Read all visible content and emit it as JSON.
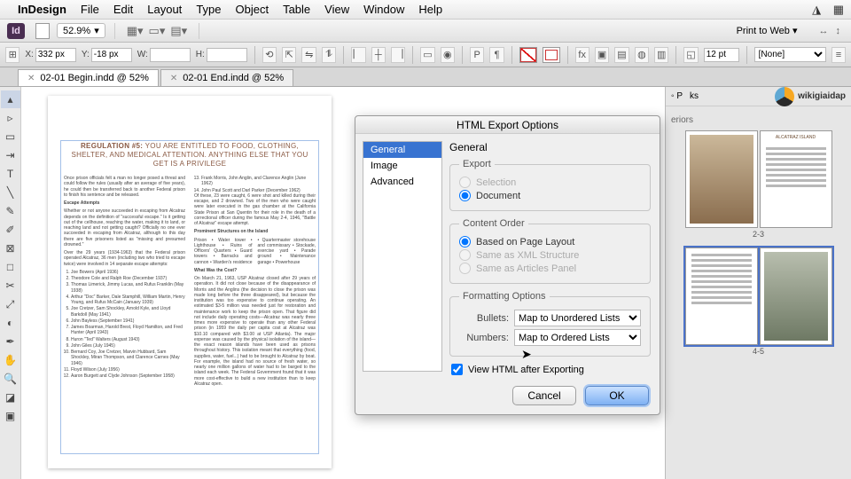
{
  "menubar": {
    "apple": "",
    "brand": "InDesign",
    "items": [
      "File",
      "Edit",
      "Layout",
      "Type",
      "Object",
      "Table",
      "View",
      "Window",
      "Help"
    ]
  },
  "appbar": {
    "id_logo": "Id",
    "zoom": "52.9%",
    "print_to_web": "Print to Web"
  },
  "control": {
    "x_label": "X:",
    "x_value": "332 px",
    "y_label": "Y:",
    "y_value": "-18 px",
    "w_label": "W:",
    "w_value": "",
    "h_label": "H:",
    "h_value": "",
    "stroke_pt": "12 pt",
    "style_none": "[None]"
  },
  "tabs": [
    {
      "label": "02-01 Begin.indd @ 52%",
      "active": true
    },
    {
      "label": "02-01 End.indd @ 52%",
      "active": false
    }
  ],
  "document": {
    "headline_label": "REGULATION #5:",
    "headline_body": "YOU ARE ENTITLED TO FOOD, CLOTHING, SHELTER, AND MEDICAL ATTENTION. ANYTHING ELSE THAT YOU GET IS A PRIVILEGE",
    "para1": "Once prison officials felt a man no longer posed a threat and could follow the rules (usually after an average of five years), he could then be transferred back to another Federal prison to finish his sentence and be released.",
    "escape_h": "Escape Attempts",
    "para2": "Whether or not anyone succeeded in escaping from Alcatraz depends on the definition of \"successful escape.\" Is it getting out of the cellhouse, reaching the water, making it to land, or reaching land and not getting caught? Officially no one ever succeeded in escaping from Alcatraz, although to this day there are five prisoners listed as \"missing and presumed drowned.\"",
    "para3": "Over the 29 years (1934-1963) that the Federal prison operated Alcatraz, 36 men (including two who tried to escape twice) were involved in 14 separate escape attempts:",
    "names": [
      "Joe Bowers (April 1936)",
      "Theodore Cole and Ralph Roe (December 1937)",
      "Thomas Limerick, Jimmy Lucas, and Rufus Franklin (May 1938)",
      "Arthur \"Doc\" Barker, Dale Stamphill, William Martin, Henry Young, and Rufus McCain (January 1939)",
      "Joe Cretzer, Sam Shockley, Arnold Kyle, and Lloyd Barkdoll (May 1941)",
      "John Bayless (September 1941)",
      "James Boarman, Harold Brest, Floyd Hamilton, and Fred Hunter (April 1943)",
      "Huron \"Ted\" Walters (August 1943)",
      "John Giles (July 1945)",
      "Bernard Coy, Joe Cretzer, Marvin Hubbard, Sam Shockley, Miran Thompson, and Clarence Carnes (May 1946)",
      "Floyd Wilson (July 1956)",
      "Aaron Burgett and Clyde Johnson (September 1958)",
      "Frank Morris, John Anglin, and Clarence Anglin (June 1962)",
      "John Paul Scott and Darl Parker (December 1962)"
    ],
    "col2p1": "Of these, 23 were caught, 6 were shot and killed during their escape, and 2 drowned. Two of the men who were caught were later executed in the gas chamber at the California State Prison at San Quentin for their role in the death of a correctional officer during the famous May 2-4, 1946, \"Battle of Alcatraz\" escape attempt.",
    "struct_h": "Prominent Structures on the Island",
    "struct_list": [
      "Prison",
      "Water tower",
      "Lighthouse",
      "Ruins of Officers' Quarters",
      "Guard towers",
      "Barracks and cannon",
      "Warden's residence",
      "Quartermaster storehouse and commissary",
      "Stockade, exercise yard",
      "Parade ground",
      "Maintenance garage",
      "Powerhouse"
    ],
    "cost_h": "What Was the Cost?",
    "col2p2": "On March 21, 1963, USP Alcatraz closed after 29 years of operation. It did not close because of the disappearance of Morris and the Anglins (the decision to close the prison was made long before the three disappeared), but because the institution was too expensive to continue operating. An estimated $3-5 million was needed just for restoration and maintenance work to keep the prison open. That figure did not include daily operating costs—Alcatraz was nearly three times more expensive to operate than any other Federal prison (in 1959 the daily per capita cost at Alcatraz was $10.10 compared with $3.00 at USP Atlanta). The major expense was caused by the physical isolation of the island—the exact reason islands have been used as prisons throughout history. This isolation meant that everything (food, supplies, water, fuel...) had to be brought to Alcatraz by boat. For example, the island had no source of fresh water, so nearly one million gallons of water had to be barged to the island each week. The Federal Government found that it was more cost-effective to build a new institution than to keep Alcatraz open."
  },
  "panels": {
    "tab_pages": "P",
    "tab_links": "ks",
    "logo_text": "wikigiaidap",
    "subtab": "eriors",
    "spread1_label": "2-3",
    "spread2_label": "4-5",
    "alcatraz_label": "ALCATRAZ ISLAND"
  },
  "dialog": {
    "title": "HTML Export Options",
    "side": {
      "general": "General",
      "image": "Image",
      "advanced": "Advanced"
    },
    "section": "General",
    "export_legend": "Export",
    "export_selection": "Selection",
    "export_document": "Document",
    "content_legend": "Content Order",
    "co_layout": "Based on Page Layout",
    "co_xml": "Same as XML Structure",
    "co_articles": "Same as Articles Panel",
    "format_legend": "Formatting Options",
    "bullets_label": "Bullets:",
    "bullets_value": "Map to Unordered Lists",
    "numbers_label": "Numbers:",
    "numbers_value": "Map to Ordered Lists",
    "view_after": "View HTML after Exporting",
    "cancel": "Cancel",
    "ok": "OK"
  }
}
